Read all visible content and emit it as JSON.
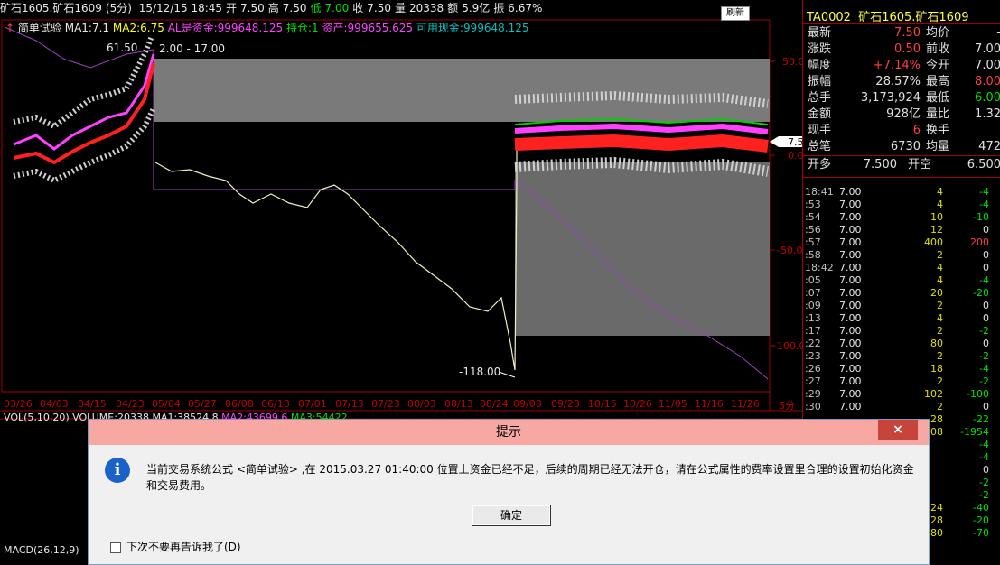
{
  "header": {
    "symbol": "矿石1605.矿石1609",
    "period": "(5分)",
    "datetime": "15/12/15 18:45",
    "open_label": "开",
    "open": "7.50",
    "high_label": "高",
    "high": "7.50",
    "low_label": "低",
    "low": "7.00",
    "close_label": "收",
    "close": "7.50",
    "vol_label": "量",
    "vol": "20338",
    "amount_label": "额",
    "amount": "5.9亿",
    "amp_label": "振",
    "amp": "6.67%",
    "refresh": "刷新"
  },
  "indicator_line": {
    "formula": "简单试验",
    "ma1": "MA1:7.1",
    "ma2": "MA2:6.75",
    "al": "AL是资金:999648.125",
    "pos": "持仓:1",
    "assets": "资产:999655.625",
    "cash": "可用现金:999648.125"
  },
  "chart_labels": {
    "peak_price": "61.50",
    "range": "2.00 - 17.00",
    "low_price": "-118.00",
    "last_price_tag": "7.5",
    "y_ticks": [
      "50.0",
      "0.0",
      "-50.0",
      "-100.0"
    ],
    "x_dates": [
      "03/26",
      "04/03",
      "04/15",
      "04/23",
      "05/04",
      "05/27",
      "06/08",
      "06/18",
      "07/01",
      "07/13",
      "07/23",
      "08/03",
      "08/13",
      "08/24",
      "09/08",
      "09/28",
      "10/15",
      "10/26",
      "11/05",
      "11/16",
      "11/26"
    ],
    "period_tag": "5分",
    "vol_line": "VOL(5,10,20) VOLUME:20338",
    "vol_ma1": "MA1:38524.8",
    "vol_ma2": "MA2:43699.6",
    "vol_ma3": "MA3:54422",
    "macd_label": "MACD(26,12,9)"
  },
  "quote": {
    "code": "TA0002",
    "name": "矿石1605.矿石1609",
    "rows": [
      {
        "l1": "最新",
        "v1": "7.50",
        "c1": "#ff4040",
        "l2": "均价",
        "v2": "-",
        "c2": "#e0e0e0"
      },
      {
        "l1": "涨跌",
        "v1": "0.50",
        "c1": "#ff4040",
        "l2": "前收",
        "v2": "7.00",
        "c2": "#e0e0e0"
      },
      {
        "l1": "幅度",
        "v1": "+7.14%",
        "c1": "#ff4040",
        "l2": "今开",
        "v2": "7.00",
        "c2": "#e0e0e0"
      },
      {
        "l1": "振幅",
        "v1": "28.57%",
        "c1": "#e0e0e0",
        "l2": "最高",
        "v2": "8.00",
        "c2": "#ff4040"
      },
      {
        "l1": "总手",
        "v1": "3,173,924",
        "c1": "#e0e0e0",
        "l2": "最低",
        "v2": "6.00",
        "c2": "#00e000"
      },
      {
        "l1": "金额",
        "v1": "928亿",
        "c1": "#e0e0e0",
        "l2": "量比",
        "v2": "1.32",
        "c2": "#e0e0e0"
      },
      {
        "l1": "现手",
        "v1": "6",
        "c1": "#ff4040",
        "l2": "换手",
        "v2": "",
        "c2": "#e0e0e0"
      },
      {
        "l1": "总笔",
        "v1": "6730",
        "c1": "#e0e0e0",
        "l2": "均量",
        "v2": "472",
        "c2": "#e0e0e0"
      }
    ],
    "open_long_label": "开多",
    "open_long": "7.500",
    "open_short_label": "开空",
    "open_short": "6.500"
  },
  "ticks": [
    {
      "t": "18:41",
      "p": "7.00",
      "v": "4",
      "c": "-4"
    },
    {
      "t": ":53",
      "p": "7.00",
      "v": "4",
      "c": "-4"
    },
    {
      "t": ":54",
      "p": "7.00",
      "v": "10",
      "c": "-10"
    },
    {
      "t": ":56",
      "p": "7.00",
      "v": "12",
      "c": "0"
    },
    {
      "t": ":57",
      "p": "7.00",
      "v": "400",
      "c": "200"
    },
    {
      "t": ":58",
      "p": "7.00",
      "v": "2",
      "c": "0"
    },
    {
      "t": "18:42",
      "p": "7.00",
      "v": "4",
      "c": "0"
    },
    {
      "t": ":05",
      "p": "7.00",
      "v": "4",
      "c": "-4"
    },
    {
      "t": ":07",
      "p": "7.00",
      "v": "20",
      "c": "-20"
    },
    {
      "t": ":09",
      "p": "7.00",
      "v": "2",
      "c": "0"
    },
    {
      "t": ":13",
      "p": "7.00",
      "v": "4",
      "c": "0"
    },
    {
      "t": ":17",
      "p": "7.00",
      "v": "2",
      "c": "-2"
    },
    {
      "t": ":22",
      "p": "7.00",
      "v": "80",
      "c": "0"
    },
    {
      "t": ":23",
      "p": "7.00",
      "v": "2",
      "c": "-2"
    },
    {
      "t": ":26",
      "p": "7.00",
      "v": "18",
      "c": "-4"
    },
    {
      "t": ":27",
      "p": "7.00",
      "v": "2",
      "c": "-2"
    },
    {
      "t": ":29",
      "p": "7.00",
      "v": "102",
      "c": "-100"
    },
    {
      "t": ":30",
      "p": "7.00",
      "v": "2",
      "c": "0"
    },
    {
      "t": "",
      "p": "",
      "v": "28",
      "c": "-22"
    },
    {
      "t": "",
      "p": "",
      "v": "08",
      "c": "-1954"
    },
    {
      "t": "",
      "p": "",
      "v": "",
      "c": "-4"
    },
    {
      "t": "",
      "p": "",
      "v": "",
      "c": "-4"
    },
    {
      "t": "",
      "p": "",
      "v": "",
      "c": "0"
    },
    {
      "t": "",
      "p": "",
      "v": "",
      "c": "-2"
    },
    {
      "t": "",
      "p": "",
      "v": "",
      "c": "-2"
    },
    {
      "t": "",
      "p": "",
      "v": "24",
      "c": "-40"
    },
    {
      "t": "",
      "p": "",
      "v": "28",
      "c": "-20"
    },
    {
      "t": "",
      "p": "",
      "v": "80",
      "c": "-70"
    }
  ],
  "dialog": {
    "title": "提示",
    "close": "×",
    "message": "当前交易系统公式 <简单试验> ,在 2015.03.27 01:40:00 位置上资金已经不足，后续的周期已经无法开仓，请在公式属性的费率设置里合理的设置初始化资金和交易费用。",
    "ok": "确定",
    "dont_tell": "下次不要再告诉我了(D)"
  }
}
